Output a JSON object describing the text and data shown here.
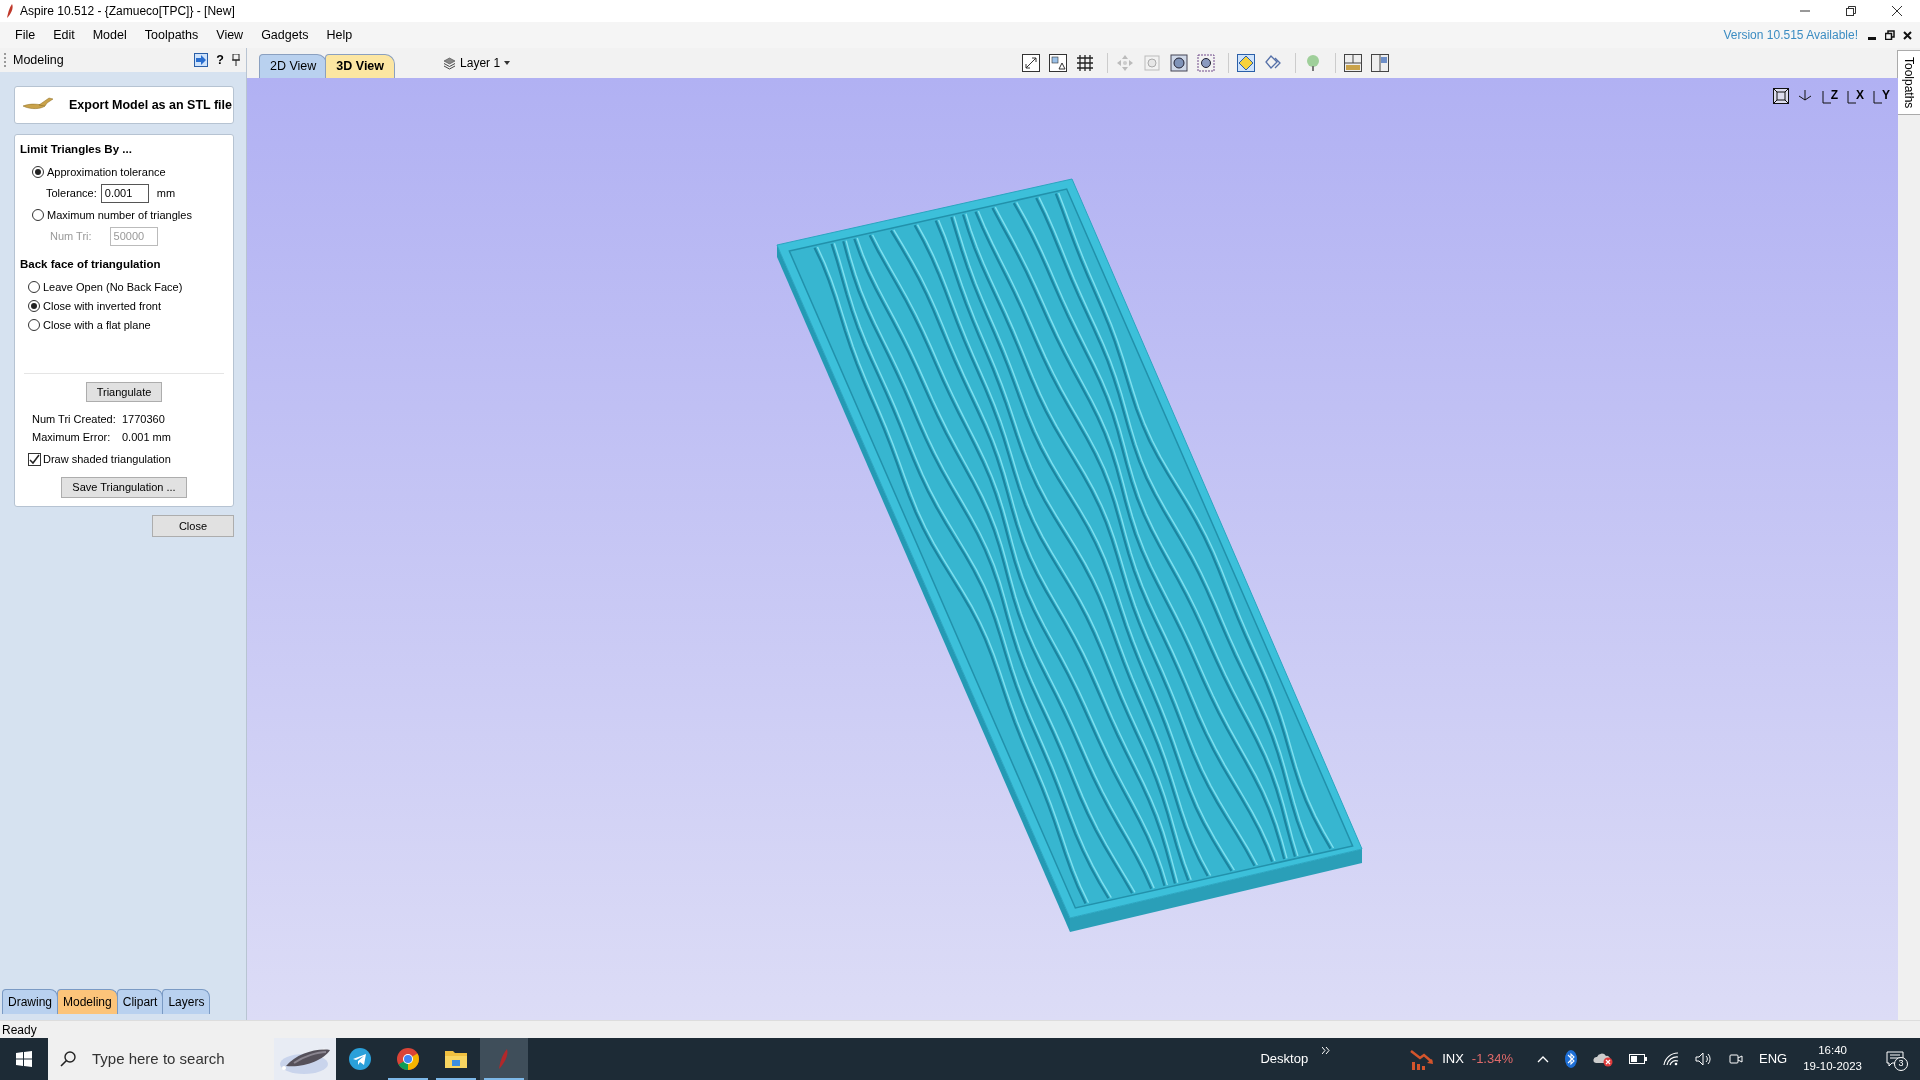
{
  "window": {
    "title": "Aspire 10.512 - {Zamueco[TPC]} - [New]"
  },
  "menu": [
    {
      "label": "File"
    },
    {
      "label": "Edit"
    },
    {
      "label": "Model"
    },
    {
      "label": "Toolpaths"
    },
    {
      "label": "View"
    },
    {
      "label": "Gadgets"
    },
    {
      "label": "Help"
    }
  ],
  "update_notice": "Version 10.515 Available!",
  "panel": {
    "title": "Modeling",
    "help": "?",
    "tool_title": "Export Model as an STL file",
    "limit": {
      "title": "Limit Triangles By ...",
      "options": [
        {
          "label": "Approximation tolerance",
          "selected": true,
          "field": {
            "label": "Tolerance:",
            "value": "0.001",
            "unit": "mm",
            "disabled": false
          }
        },
        {
          "label": "Maximum number of triangles",
          "selected": false,
          "field": {
            "label": "Num Tri:",
            "value": "50000",
            "disabled": true
          }
        }
      ]
    },
    "back_face": {
      "title": "Back face of triangulation",
      "options": [
        {
          "label": "Leave Open (No Back Face)",
          "selected": false
        },
        {
          "label": "Close with inverted front",
          "selected": true
        },
        {
          "label": "Close with a flat plane",
          "selected": false
        }
      ]
    },
    "triangulate_button": "Triangulate",
    "results": [
      {
        "label": "Num Tri Created:",
        "value": "1770360"
      },
      {
        "label": "Maximum Error:",
        "value": "0.001 mm"
      }
    ],
    "draw_shaded": {
      "label": "Draw shaded triangulation",
      "checked": true
    },
    "save_button": "Save Triangulation ...",
    "close_button": "Close"
  },
  "panel_tabs": [
    {
      "label": "Drawing",
      "selected": false
    },
    {
      "label": "Modeling",
      "selected": true
    },
    {
      "label": "Clipart",
      "selected": false
    },
    {
      "label": "Layers",
      "selected": false
    }
  ],
  "view_tabs": [
    {
      "label": "2D View",
      "selected": false
    },
    {
      "label": "3D View",
      "selected": true
    }
  ],
  "layer": "Layer 1",
  "axis_views": [
    "Z",
    "X",
    "Y"
  ],
  "side_tab": "Toolpaths",
  "status": "Ready",
  "taskbar": {
    "search_placeholder": "Type here to search",
    "apps": [
      {
        "kind": "telegram",
        "selected": false,
        "running": false
      },
      {
        "kind": "chrome",
        "selected": false,
        "running": true
      },
      {
        "kind": "folder",
        "selected": false,
        "running": true
      },
      {
        "kind": "aspire",
        "selected": true,
        "running": true
      }
    ],
    "toolbar_label": "Desktop",
    "stock": {
      "symbol": "INX",
      "change": "-1.34%"
    },
    "language": "ENG",
    "time": "16:40",
    "date": "19-10-2023",
    "notification_count": "3"
  }
}
